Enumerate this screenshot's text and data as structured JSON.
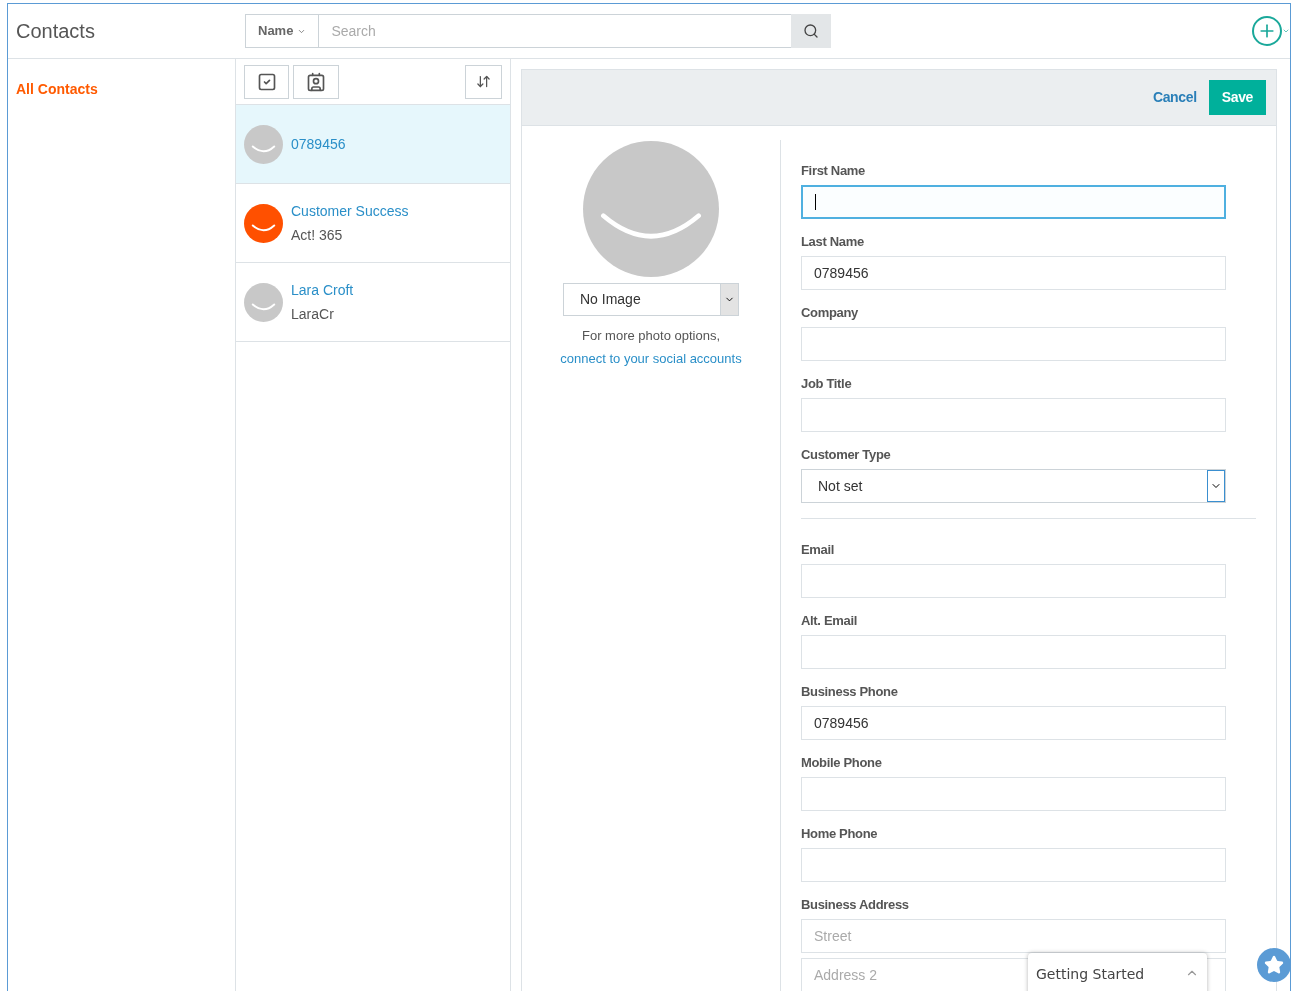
{
  "header": {
    "title": "Contacts",
    "search_by": "Name",
    "search": {
      "placeholder": "Search"
    }
  },
  "sidebar": {
    "items": [
      {
        "label": "All Contacts",
        "selected": true
      }
    ]
  },
  "contacts": [
    {
      "name": "0789456",
      "selected": true,
      "color": "#c8c8c8"
    },
    {
      "name": "Customer Success",
      "subtitle": "Act! 365",
      "selected": false,
      "color": "#ff5000"
    },
    {
      "name": "Lara Croft",
      "subtitle": "LaraCr",
      "selected": false,
      "color": "#c8c8c8"
    }
  ],
  "editor": {
    "cancel": "Cancel",
    "save": "Save",
    "photo": {
      "select": "No Image",
      "hint": "For more photo options,",
      "link": "connect to your social accounts"
    },
    "fields": [
      {
        "kind": "text",
        "label": "First Name",
        "focused": true
      },
      {
        "kind": "text",
        "label": "Last Name",
        "value": "0789456",
        "focused": false
      },
      {
        "kind": "text",
        "label": "Company",
        "focused": false
      },
      {
        "kind": "text",
        "label": "Job Title",
        "focused": false
      },
      {
        "kind": "select",
        "label": "Customer Type",
        "value": "Not set"
      },
      {
        "kind": "divider"
      },
      {
        "kind": "text",
        "label": "Email",
        "focused": false
      },
      {
        "kind": "text",
        "label": "Alt. Email",
        "focused": false
      },
      {
        "kind": "text",
        "label": "Business Phone",
        "value": "0789456",
        "focused": false
      },
      {
        "kind": "text",
        "label": "Mobile Phone",
        "focused": false
      },
      {
        "kind": "text",
        "label": "Home Phone",
        "focused": false
      },
      {
        "kind": "address",
        "label": "Business Address",
        "placeholders": [
          "Street",
          "Address 2"
        ]
      }
    ]
  },
  "getting_started": {
    "label": "Getting Started",
    "expanded": false
  }
}
